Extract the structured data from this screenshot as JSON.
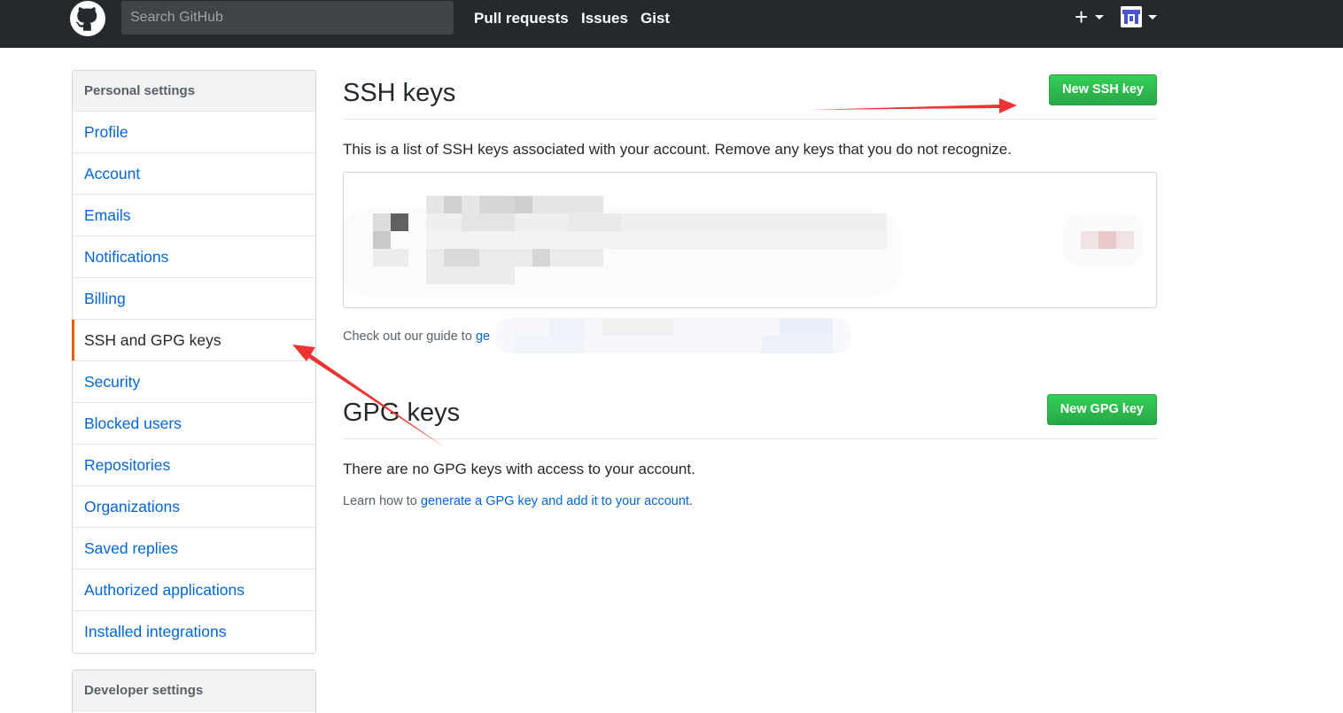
{
  "header": {
    "search_placeholder": "Search GitHub",
    "nav": [
      "Pull requests",
      "Issues",
      "Gist"
    ],
    "plus_label": "+"
  },
  "sidebar": {
    "heading": "Personal settings",
    "items": [
      {
        "label": "Profile"
      },
      {
        "label": "Account"
      },
      {
        "label": "Emails"
      },
      {
        "label": "Notifications"
      },
      {
        "label": "Billing"
      },
      {
        "label": "SSH and GPG keys",
        "selected": true
      },
      {
        "label": "Security"
      },
      {
        "label": "Blocked users"
      },
      {
        "label": "Repositories"
      },
      {
        "label": "Organizations"
      },
      {
        "label": "Saved replies"
      },
      {
        "label": "Authorized applications"
      },
      {
        "label": "Installed integrations"
      }
    ],
    "developer_heading": "Developer settings"
  },
  "ssh": {
    "title": "SSH keys",
    "new_button": "New SSH key",
    "description": "This is a list of SSH keys associated with your account. Remove any keys that you do not recognize.",
    "guide_prefix": "Check out our guide to ",
    "guide_link_visible": "ge"
  },
  "gpg": {
    "title": "GPG keys",
    "new_button": "New GPG key",
    "empty": "There are no GPG keys with access to your account.",
    "learn_prefix": "Learn how to ",
    "learn_link": "generate a GPG key and add it to your account",
    "learn_suffix": "."
  },
  "colors": {
    "header_bg": "#24292e",
    "link": "#0366d6",
    "button_green": "#28a745",
    "selected_bar": "#e36209",
    "annotation_arrow": "#ee3333"
  }
}
